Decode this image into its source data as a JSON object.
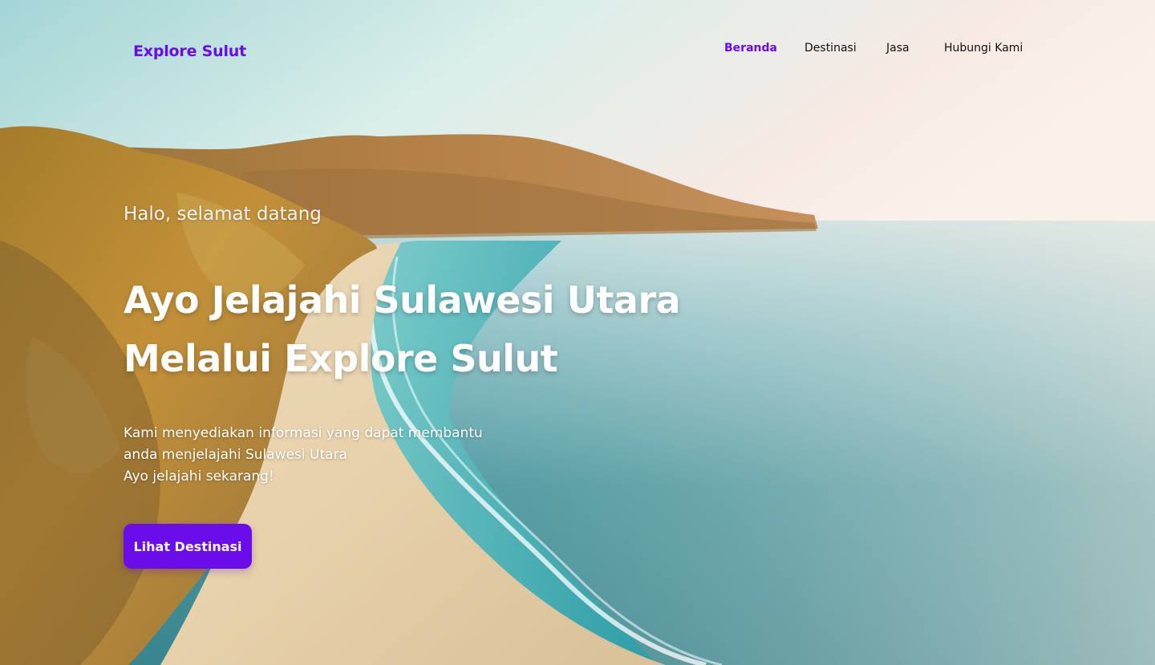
{
  "brand": {
    "name": "Explore Sulut"
  },
  "nav": {
    "items": [
      {
        "label": "Beranda",
        "active": true
      },
      {
        "label": "Destinasi",
        "active": false
      },
      {
        "label": "Jasa",
        "active": false
      },
      {
        "label": "Hubungi Kami",
        "active": false
      }
    ]
  },
  "hero": {
    "greeting": "Halo, selamat datang",
    "headline_line1": "Ayo Jelajahi Sulawesi Utara",
    "headline_line2": "Melalui Explore Sulut",
    "description_line1": "Kami menyediakan informasi yang dapat membantu",
    "description_line2": "anda menjelajahi Sulawesi Utara",
    "description_line3": "Ayo jelajahi sekarang!",
    "cta_label": "Lihat Destinasi"
  },
  "colors": {
    "accent": "#6a0dea",
    "nav_text": "#111111",
    "hero_text": "#ffffff"
  }
}
